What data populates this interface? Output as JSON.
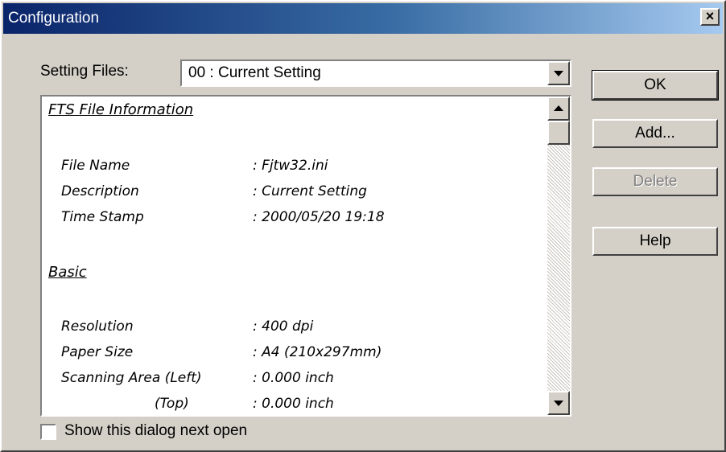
{
  "window": {
    "title": "Configuration",
    "close_glyph": "×"
  },
  "setting_files": {
    "label": "Setting Files:",
    "selected": "00 : Current Setting"
  },
  "info": {
    "fts_heading": "FTS File Information",
    "fts_rows": [
      {
        "label": "File Name",
        "value": ":  Fjtw32.ini"
      },
      {
        "label": "Description",
        "value": ":  Current Setting"
      },
      {
        "label": "Time Stamp",
        "value": ":  2000/05/20 19:18"
      }
    ],
    "basic_heading": "Basic",
    "basic_rows": [
      {
        "label": "Resolution",
        "value": ":  400 dpi"
      },
      {
        "label": "Paper Size",
        "value": ":  A4 (210x297mm)"
      },
      {
        "label": "Scanning Area (Left)",
        "value": ":  0.000 inch"
      },
      {
        "label": "(Top)",
        "value": ":  0.000 inch"
      }
    ]
  },
  "buttons": {
    "ok": "OK",
    "add": "Add...",
    "delete": "Delete",
    "help": "Help"
  },
  "checkbox": {
    "label": "Show this dialog next open",
    "checked": false
  },
  "icons": [
    "close-icon",
    "dropdown-arrow-icon",
    "scroll-up-icon",
    "scroll-down-icon"
  ]
}
